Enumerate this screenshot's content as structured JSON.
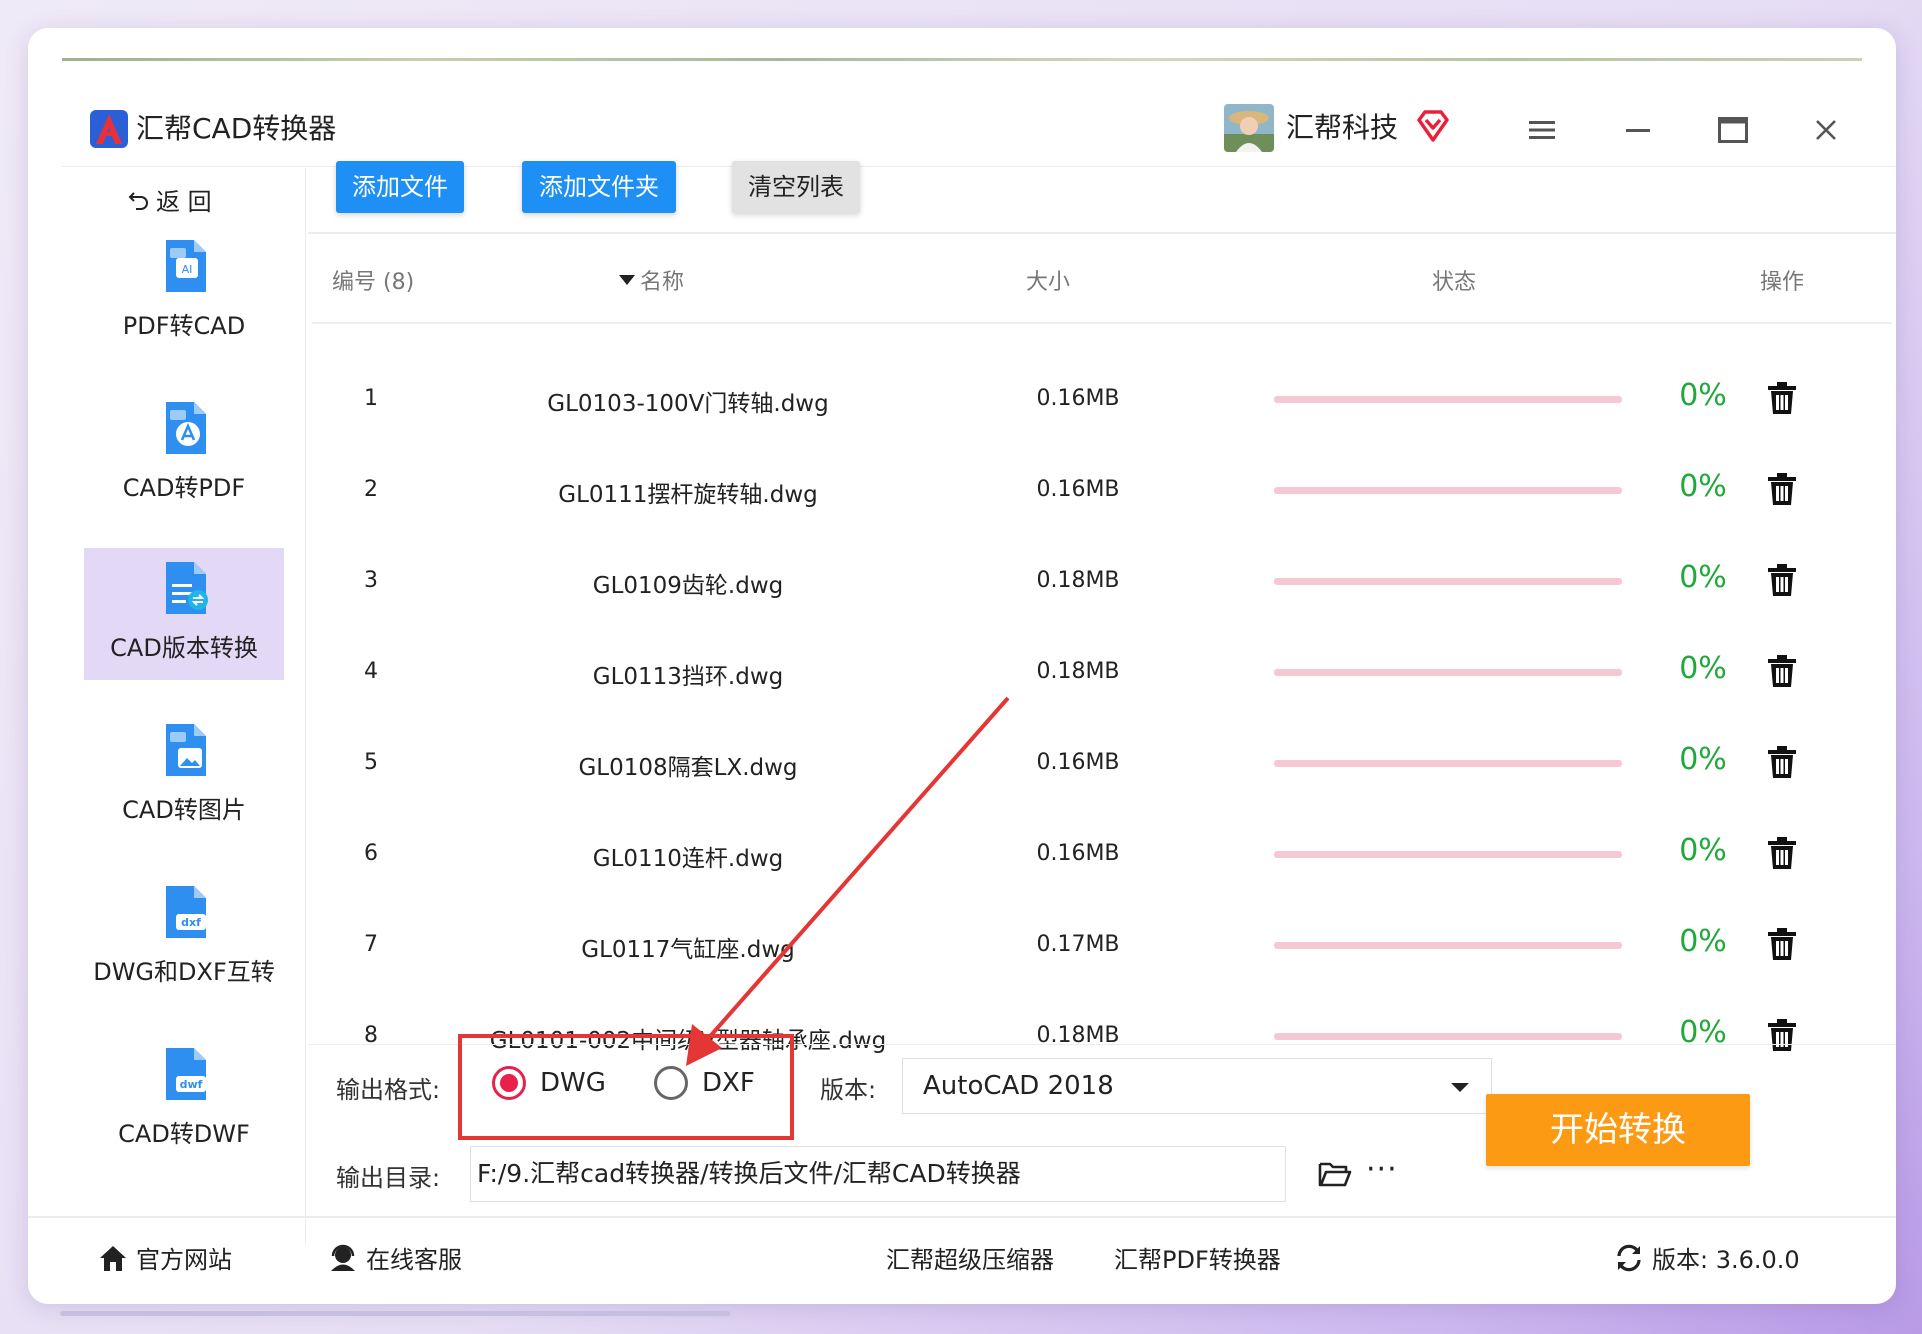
{
  "app": {
    "title": "汇帮CAD转换器",
    "user_name": "汇帮科技"
  },
  "sidebar": {
    "back_label": "返 回",
    "items": [
      {
        "label": "PDF转CAD"
      },
      {
        "label": "CAD转PDF"
      },
      {
        "label": "CAD版本转换",
        "active": true
      },
      {
        "label": "CAD转图片"
      },
      {
        "label": "DWG和DXF互转"
      },
      {
        "label": "CAD转DWF"
      }
    ]
  },
  "toolbar": {
    "add_file": "添加文件",
    "add_folder": "添加文件夹",
    "clear_list": "清空列表"
  },
  "table": {
    "headers": {
      "num": "编号 (8)",
      "name": "名称",
      "size": "大小",
      "status": "状态",
      "action": "操作"
    },
    "rows": [
      {
        "num": "1",
        "name": "GL0103-100V门转轴.dwg",
        "size": "0.16MB",
        "progress": 0,
        "percent": "0%"
      },
      {
        "num": "2",
        "name": "GL0111摆杆旋转轴.dwg",
        "size": "0.16MB",
        "progress": 0,
        "percent": "0%"
      },
      {
        "num": "3",
        "name": "GL0109齿轮.dwg",
        "size": "0.18MB",
        "progress": 0,
        "percent": "0%"
      },
      {
        "num": "4",
        "name": "GL0113挡环.dwg",
        "size": "0.18MB",
        "progress": 0,
        "percent": "0%"
      },
      {
        "num": "5",
        "name": "GL0108隔套LX.dwg",
        "size": "0.16MB",
        "progress": 0,
        "percent": "0%"
      },
      {
        "num": "6",
        "name": "GL0110连杆.dwg",
        "size": "0.16MB",
        "progress": 0,
        "percent": "0%"
      },
      {
        "num": "7",
        "name": "GL0117气缸座.dwg",
        "size": "0.17MB",
        "progress": 0,
        "percent": "0%"
      },
      {
        "num": "8",
        "name": "GL0101-002中间级V型器轴承座.dwg",
        "size": "0.18MB",
        "progress": 0,
        "percent": "0%"
      }
    ]
  },
  "options": {
    "format_label": "输出格式:",
    "format_options": [
      "DWG",
      "DXF"
    ],
    "format_selected": "DWG",
    "version_label": "版本:",
    "version_value": "AutoCAD 2018",
    "dir_label": "输出目录:",
    "dir_value": "F:/9.汇帮cad转换器/转换后文件/汇帮CAD转换器",
    "more_label": "···",
    "start_label": "开始转换"
  },
  "footer": {
    "website": "官方网站",
    "service": "在线客服",
    "compressor": "汇帮超级压缩器",
    "pdf_converter": "汇帮PDF转换器",
    "version": "版本:  3.6.0.0"
  },
  "colors": {
    "accent_blue": "#1e8ff5",
    "start_orange": "#fc9a14",
    "progress_pink": "#f6c8d4",
    "percent_green": "#20a83b",
    "radio_red": "#e8204a",
    "active_sidebar": "#e3d9f7",
    "annotation_red": "#e53636"
  }
}
